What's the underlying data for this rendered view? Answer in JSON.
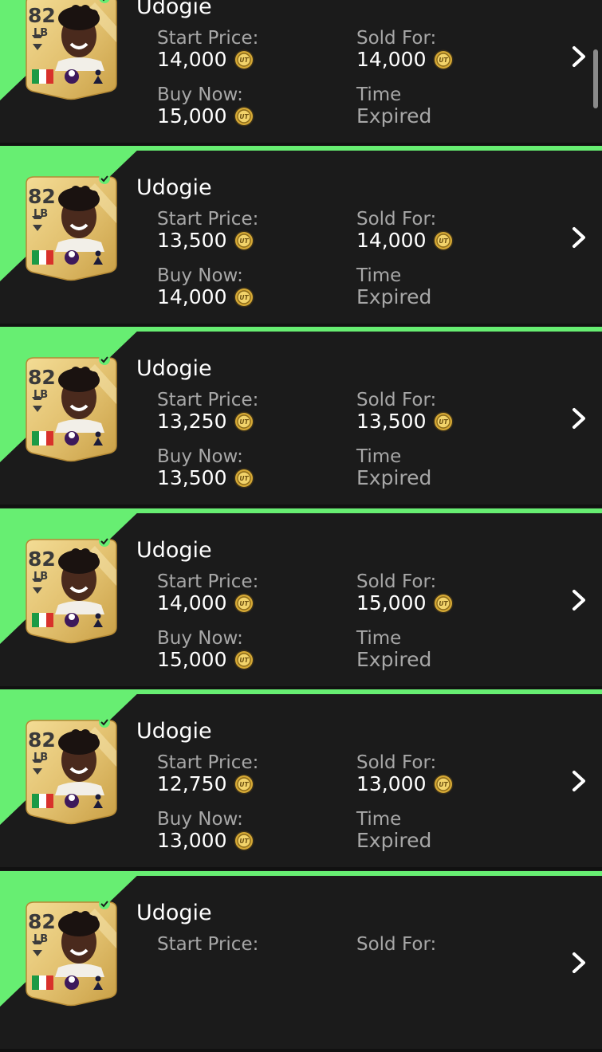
{
  "colors": {
    "row_background": "#1b1b1b",
    "accent_green": "#67ee72",
    "card_gold": "#e3c271",
    "label_gray": "#a7a7a7",
    "value_white": "#ffffff"
  },
  "labels": {
    "start_price": "Start Price:",
    "sold_for": "Sold For:",
    "buy_now": "Buy Now:",
    "time": "Time"
  },
  "icons": {
    "coin": "ut-coin-icon",
    "chevron": "chevron-right-icon",
    "flag": "italy-flag-icon",
    "league": "premier-league-icon",
    "club": "tottenham-badge-icon",
    "check": "checkmark-icon"
  },
  "items": [
    {
      "player": "Udogie",
      "rating": "82",
      "position": "LB",
      "start_price": "14,000",
      "sold_for": "14,000",
      "buy_now": "15,000",
      "time": "Expired"
    },
    {
      "player": "Udogie",
      "rating": "82",
      "position": "LB",
      "start_price": "13,500",
      "sold_for": "14,000",
      "buy_now": "14,000",
      "time": "Expired"
    },
    {
      "player": "Udogie",
      "rating": "82",
      "position": "LB",
      "start_price": "13,250",
      "sold_for": "13,500",
      "buy_now": "13,500",
      "time": "Expired"
    },
    {
      "player": "Udogie",
      "rating": "82",
      "position": "LB",
      "start_price": "14,000",
      "sold_for": "15,000",
      "buy_now": "15,000",
      "time": "Expired"
    },
    {
      "player": "Udogie",
      "rating": "82",
      "position": "LB",
      "start_price": "12,750",
      "sold_for": "13,000",
      "buy_now": "13,000",
      "time": "Expired"
    },
    {
      "player": "Udogie",
      "rating": "82",
      "position": "LB",
      "start_price": "",
      "sold_for": "",
      "buy_now": "",
      "time": ""
    }
  ]
}
